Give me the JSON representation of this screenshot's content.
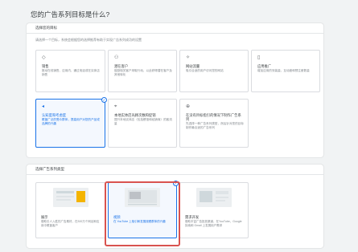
{
  "page_title": "您的广告系列目标是什么?",
  "goal_section": {
    "header": "选择您的目标",
    "subtitle": "请选择一个目标，系统会根据您的选择推荐有助于实现广告系列成功的设置",
    "tiles": [
      {
        "icon": "tag-icon",
        "glyph": "◇",
        "name": "销售",
        "desc": "推动在线销售、应用内、通过电话或在实体店销售",
        "selected": false
      },
      {
        "icon": "people-icon",
        "glyph": "⚇",
        "name": "潜在客户",
        "desc": "鼓励相关客户采取行动，以此获得潜在客户及其他转化",
        "selected": false
      },
      {
        "icon": "cursor-icon",
        "glyph": "✧",
        "name": "网站流量",
        "desc": "吸引合适的用户访问您的网站",
        "selected": false
      },
      {
        "icon": "phone-icon",
        "glyph": "▯",
        "name": "应用推广",
        "desc": "增加应用的安装量、互动度和预注册数量",
        "selected": false
      },
      {
        "icon": "megaphone-icon",
        "glyph": "◂",
        "name": "认知度和考虑度",
        "desc": "覆盖广泛的受众群体，提高用户对您的产品或品牌的兴趣",
        "selected": true
      },
      {
        "icon": "location-pin-icon",
        "glyph": "⌖",
        "name": "本地实体店光顾次数和促销",
        "desc": "提升本地实体店（包括餐馆和经销商）的客流量",
        "selected": false
      },
      {
        "icon": "plus-circle-icon",
        "glyph": "⊕",
        "name": "在没有目标指引的情况下制作广告系列",
        "desc": "先选择一种广告系列类型，然后针对您的目标制作最合适的广告系列",
        "selected": false
      }
    ]
  },
  "type_section": {
    "header": "选择广告系列类型",
    "tiles": [
      {
        "name": "展示",
        "desc": "借助引人入胜的广告素材，在300万个网站和应用中覆盖客户",
        "selected": false
      },
      {
        "name": "视频",
        "desc": "在 YouTube 上吸引和发展观看群体的兴趣",
        "selected": true
      },
      {
        "name": "需求开发",
        "desc": "借助丰富广告投放渠道，在YouTube、Google 探索和 Gmail 上发展用户需求",
        "selected": false
      }
    ]
  }
}
